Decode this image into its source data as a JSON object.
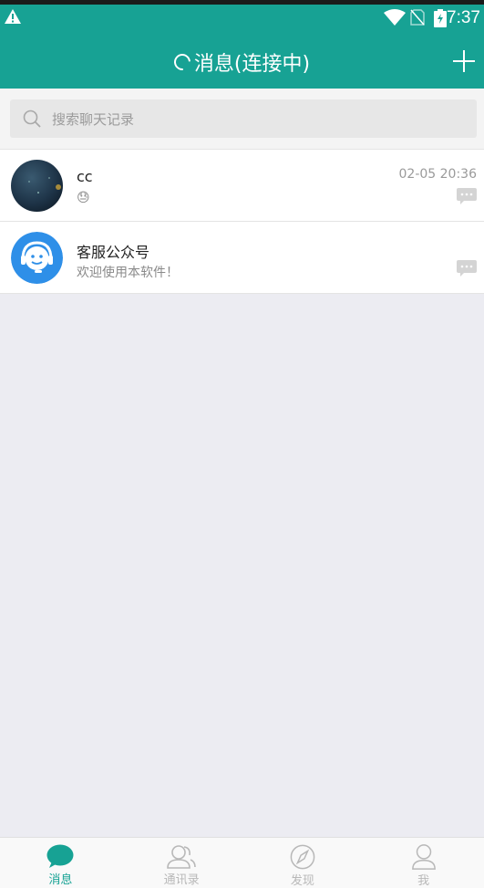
{
  "status_bar": {
    "time": "7:37"
  },
  "app_bar": {
    "title": "消息(连接中)"
  },
  "search": {
    "placeholder": "搜索聊天记录"
  },
  "conversations": [
    {
      "name": "cc",
      "preview": "😓",
      "time": "02-05 20:36"
    },
    {
      "name": "客服公众号",
      "preview": "欢迎使用本软件！",
      "time": ""
    }
  ],
  "tabs": [
    {
      "label": "消息",
      "icon": "chat-bubble-icon",
      "active": true
    },
    {
      "label": "通讯录",
      "icon": "contacts-icon",
      "active": false
    },
    {
      "label": "发现",
      "icon": "compass-icon",
      "active": false
    },
    {
      "label": "我",
      "icon": "person-icon",
      "active": false
    }
  ],
  "colors": {
    "accent": "#17a294",
    "background": "#ececf2",
    "inactive_tab": "#b8b8b8"
  }
}
